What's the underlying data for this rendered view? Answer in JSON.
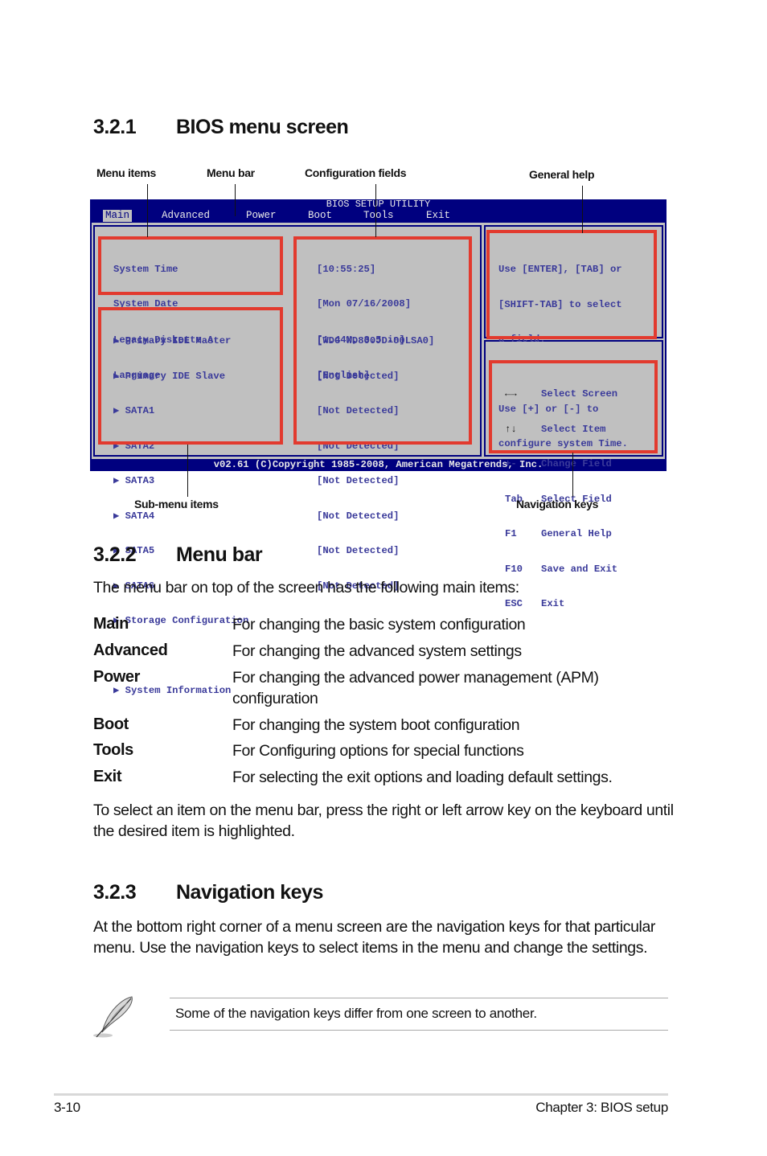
{
  "section_221": {
    "number": "3.2.1",
    "title": "BIOS menu screen"
  },
  "callouts": {
    "menu_items": "Menu items",
    "menu_bar": "Menu bar",
    "config_fields": "Configuration fields",
    "general_help": "General help",
    "submenu_items": "Sub-menu items",
    "nav_keys": "Navigation keys"
  },
  "bios": {
    "title": "BIOS SETUP UTILITY",
    "menu": [
      "Main",
      "Advanced",
      "Power",
      "Boot",
      "Tools",
      "Exit"
    ],
    "active_menu": "Main",
    "menu_items": [
      "System Time",
      "System Date",
      "Legacy Diskette A",
      "Language"
    ],
    "config_values": [
      "[10:55:25]",
      "[Mon 07/16/2008]",
      "[1.44M, 3.5 in]",
      "[English]"
    ],
    "submenu_items": [
      "Primary IDE Master",
      "Primary IDE Slave",
      "SATA1",
      "SATA2",
      "SATA3",
      "SATA4",
      "SATA5",
      "SATA6",
      "Storage Configuration",
      "System Information"
    ],
    "submenu_values": [
      "[WDC WD800JD-00LSA0]",
      "[Not Detected]",
      "[Not Detected]",
      "[Not Detected]",
      "[Not Detected]",
      "[Not Detected]",
      "[Not Detected]",
      "[Not Detected]"
    ],
    "submenu_arrow": "▶",
    "help_lines": [
      "Use [ENTER], [TAB] or",
      "[SHIFT-TAB] to select",
      "a field.",
      "",
      "Use [+] or [-] to",
      "configure system Time."
    ],
    "nav_keys": [
      {
        "key": "←→",
        "icon": "left-right-arrows-icon",
        "action": "Select Screen"
      },
      {
        "key": "↑↓",
        "icon": "up-down-arrows-icon",
        "action": "Select Item"
      },
      {
        "key": "+-",
        "action": "Change Field"
      },
      {
        "key": "Tab",
        "action": "Select Field"
      },
      {
        "key": "F1",
        "action": "General Help"
      },
      {
        "key": "F10",
        "action": "Save and Exit"
      },
      {
        "key": "ESC",
        "action": "Exit"
      }
    ],
    "footer": "v02.61 (C)Copyright 1985-2008, American Megatrends, Inc.",
    "colors": {
      "background": "#00007f",
      "panel": "#c0c0c0",
      "text": "#3a3a9a",
      "highlight_box": "#e23a2e"
    }
  },
  "section_222": {
    "number": "3.2.2",
    "title": "Menu bar",
    "intro": "The menu bar on top of the screen has the following main items:",
    "items": [
      {
        "term": "Main",
        "desc": "For changing the basic system configuration"
      },
      {
        "term": "Advanced",
        "desc": "For changing the advanced system settings"
      },
      {
        "term": "Power",
        "desc": "For changing the advanced power management (APM) configuration"
      },
      {
        "term": "Boot",
        "desc": "For changing the system boot configuration"
      },
      {
        "term": "Tools",
        "desc": "For Configuring options for special functions"
      },
      {
        "term": "Exit",
        "desc": "For selecting the exit options and loading default settings."
      }
    ],
    "outro": "To select an item on the menu bar, press the right or left arrow key on the keyboard until the desired item is highlighted."
  },
  "section_223": {
    "number": "3.2.3",
    "title": "Navigation keys",
    "body": "At the bottom right corner of a menu screen are the navigation keys for that particular menu. Use the navigation keys to select items in the menu and change the settings."
  },
  "note": {
    "icon": "feather-pen-icon",
    "text": "Some of the navigation keys differ from one screen to another."
  },
  "footer": {
    "page": "3-10",
    "chapter": "Chapter 3: BIOS setup"
  }
}
